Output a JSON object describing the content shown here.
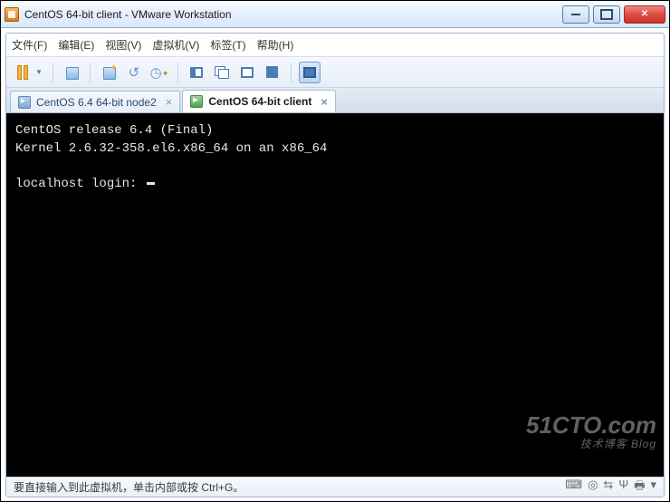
{
  "window": {
    "title": "CentOS 64-bit client - VMware Workstation"
  },
  "menu": {
    "file": "文件(F)",
    "edit": "编辑(E)",
    "view": "视图(V)",
    "vm": "虚拟机(V)",
    "tabs": "标签(T)",
    "help": "帮助(H)"
  },
  "tabs": [
    {
      "label": "CentOS 6.4 64-bit node2",
      "active": false
    },
    {
      "label": "CentOS 64-bit client",
      "active": true
    }
  ],
  "terminal": {
    "line1": "CentOS release 6.4 (Final)",
    "line2": "Kernel 2.6.32-358.el6.x86_64 on an x86_64",
    "blank": "",
    "prompt": "localhost login: "
  },
  "watermark": {
    "main": "51CTO.com",
    "sub": "技术博客  Blog"
  },
  "status": {
    "text": "要直接输入到此虚拟机，单击内部或按 Ctrl+G。"
  }
}
